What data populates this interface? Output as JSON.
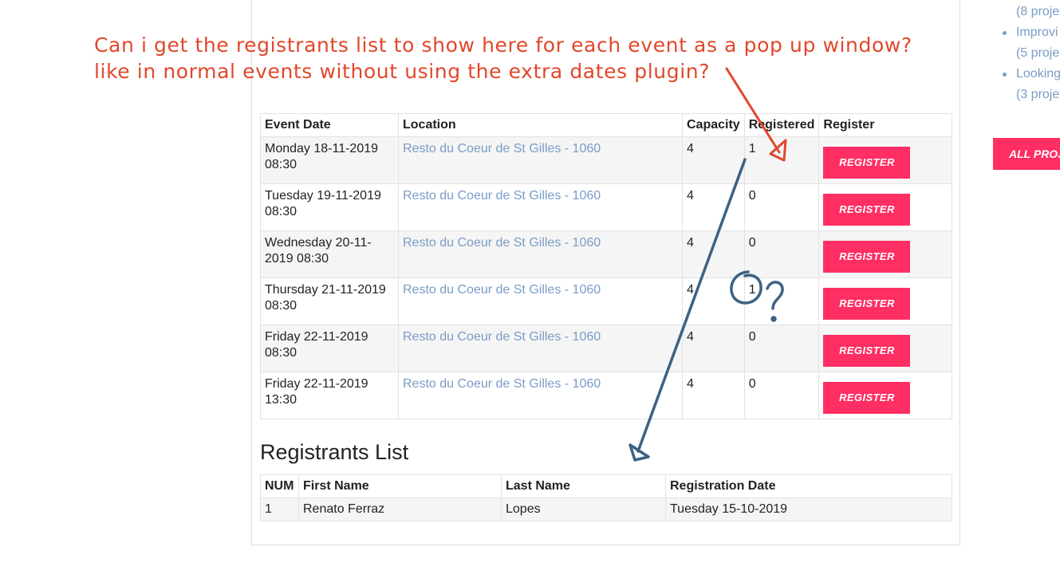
{
  "annotation": {
    "line1": "Can i get the registrants list to show here for each event as a pop up window?",
    "line2": "like in normal events without using the extra dates plugin?"
  },
  "events_table": {
    "headers": [
      "Event Date",
      "Location",
      "Capacity",
      "Registered",
      "Register"
    ],
    "rows": [
      {
        "date_line1": "Monday 18-11-2019",
        "date_line2": "08:30",
        "location": "Resto du Coeur de St Gilles - 1060",
        "capacity": "4",
        "registered": "1",
        "button": "REGISTER"
      },
      {
        "date_line1": "Tuesday 19-11-2019",
        "date_line2": "08:30",
        "location": "Resto du Coeur de St Gilles - 1060",
        "capacity": "4",
        "registered": "0",
        "button": "REGISTER"
      },
      {
        "date_line1": "Wednesday 20-11-",
        "date_line2": "2019 08:30",
        "location": "Resto du Coeur de St Gilles - 1060",
        "capacity": "4",
        "registered": "0",
        "button": "REGISTER"
      },
      {
        "date_line1": "Thursday 21-11-2019",
        "date_line2": "08:30",
        "location": "Resto du Coeur de St Gilles - 1060",
        "capacity": "4",
        "registered": "1",
        "button": "REGISTER"
      },
      {
        "date_line1": "Friday 22-11-2019",
        "date_line2": "08:30",
        "location": "Resto du Coeur de St Gilles - 1060",
        "capacity": "4",
        "registered": "0",
        "button": "REGISTER"
      },
      {
        "date_line1": "Friday 22-11-2019",
        "date_line2": "13:30",
        "location": "Resto du Coeur de St Gilles - 1060",
        "capacity": "4",
        "registered": "0",
        "button": "REGISTER"
      }
    ]
  },
  "registrants": {
    "title": "Registrants List",
    "headers": [
      "NUM",
      "First Name",
      "Last Name",
      "Registration Date"
    ],
    "rows": [
      {
        "num": "1",
        "first": "Renato Ferraz",
        "last": "Lopes",
        "date": "Tuesday 15-10-2019"
      }
    ]
  },
  "sidebar": {
    "items": [
      {
        "text": "(8 proje",
        "bullet": false
      },
      {
        "text": "Improvi",
        "bullet": true
      },
      {
        "text": "(5 proje",
        "bullet": false
      },
      {
        "text": "Looking",
        "bullet": true
      },
      {
        "text": "(3 proje",
        "bullet": false
      }
    ],
    "all_projects": "ALL PROJ"
  },
  "colors": {
    "accent": "#ff2e63",
    "link": "#7a9cc6",
    "annotation_red": "#e2472b",
    "annotation_blue": "#3d6283"
  }
}
